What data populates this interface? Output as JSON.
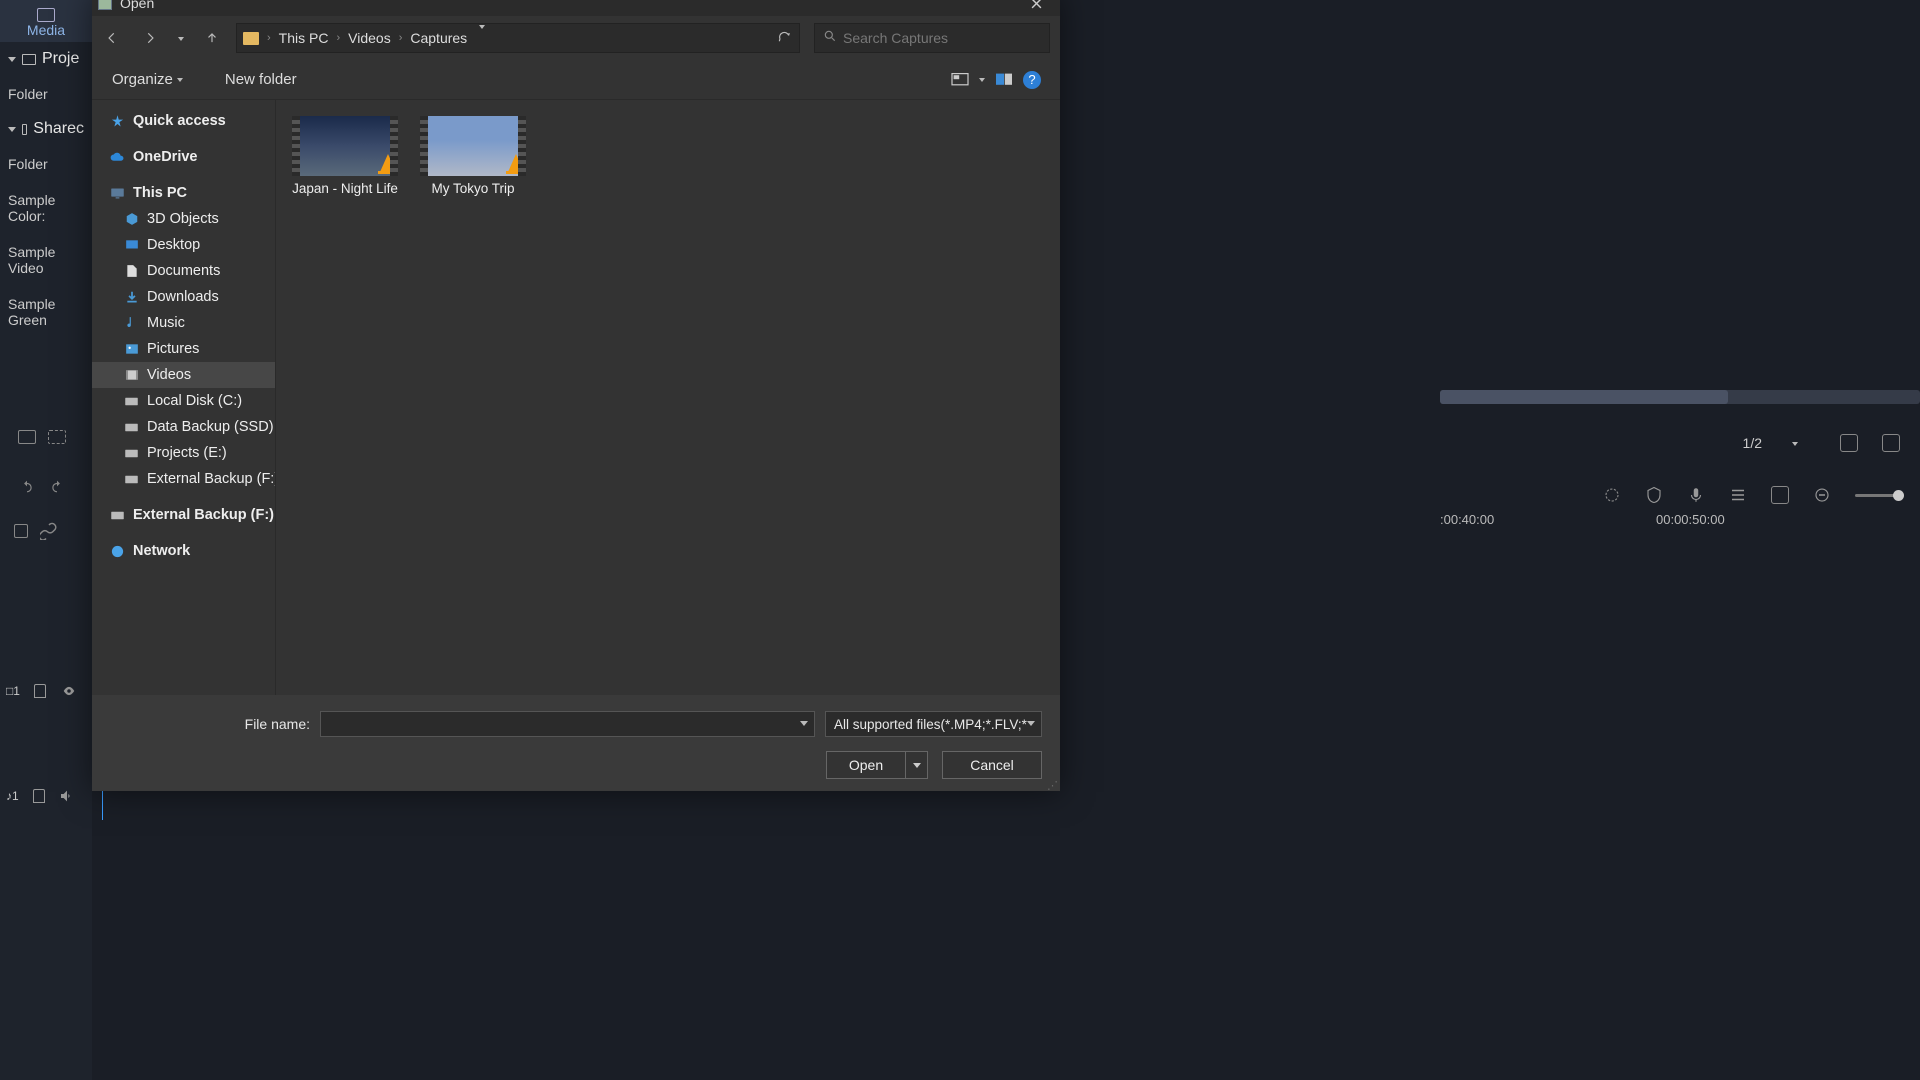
{
  "bg": {
    "media_tab": "Media",
    "project": "Proje",
    "folder": "Folder",
    "shared": "Sharec",
    "items": [
      "Sample Color:",
      "Sample Video",
      "Sample Green"
    ],
    "page_indicator": "1/2",
    "timecodes": [
      ":00:40:00",
      "00:00:50:00"
    ]
  },
  "dialog": {
    "title": "Open",
    "search_placeholder": "Search Captures",
    "toolbar": {
      "organize": "Organize",
      "new_folder": "New folder"
    },
    "breadcrumbs": [
      "This PC",
      "Videos",
      "Captures"
    ],
    "tree": {
      "quick_access": "Quick access",
      "onedrive": "OneDrive",
      "this_pc": "This PC",
      "items": [
        "3D Objects",
        "Desktop",
        "Documents",
        "Downloads",
        "Music",
        "Pictures",
        "Videos",
        "Local Disk (C:)",
        "Data Backup (SSD)",
        "Projects (E:)",
        "External Backup (F:)"
      ],
      "external2": "External Backup (F:)",
      "network": "Network"
    },
    "files": [
      {
        "name": "Japan - Night Life"
      },
      {
        "name": "My Tokyo Trip"
      }
    ],
    "file_name_label": "File name:",
    "file_name_value": "",
    "filter": "All supported files(*.MP4;*.FLV;*",
    "open_btn": "Open",
    "cancel_btn": "Cancel"
  },
  "track": {
    "v1": "1",
    "a1": "1"
  }
}
